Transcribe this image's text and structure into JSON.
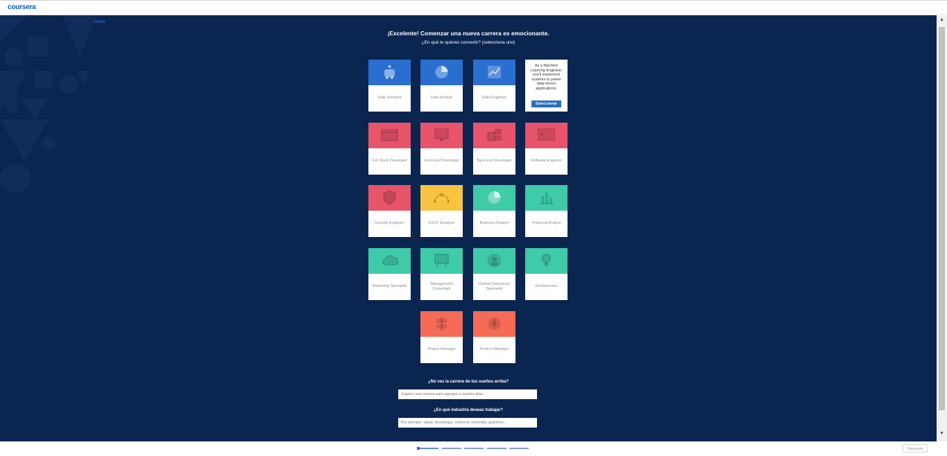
{
  "header": {
    "logo": "coursera"
  },
  "nav": {
    "back_label": "Volver"
  },
  "heading": {
    "title": "¡Excelente! Comenzar una nueva carrera es emocionante.",
    "subtitle": "¿En qué te quieres convertir? (selecciona uno)"
  },
  "careers": [
    {
      "label": "Data Scientist",
      "color": "#2a6fd0",
      "icon": "robot-icon"
    },
    {
      "label": "Data Analyst",
      "color": "#2a6fd0",
      "icon": "pie-chart-icon"
    },
    {
      "label": "Data Engineer",
      "color": "#2a6fd0",
      "icon": "line-chart-icon"
    },
    {
      "label": "Machine Learning Engineer",
      "color": "#2a6fd0",
      "icon": "brain-icon",
      "selected": true,
      "description": "As a Machine Learning Engineer, you'll implement systems to power data-driven applications.",
      "select_label": "Seleccionar"
    },
    {
      "label": "Full Stack Developer",
      "color": "#e8546a",
      "icon": "browser-icon"
    },
    {
      "label": "Front End Developer",
      "color": "#e8546a",
      "icon": "code-monitor-icon"
    },
    {
      "label": "Back End Developer",
      "color": "#e8546a",
      "icon": "server-icon"
    },
    {
      "label": "Software Engineer",
      "color": "#e8546a",
      "icon": "terminal-icon"
    },
    {
      "label": "Security Engineer",
      "color": "#e8546a",
      "icon": "shield-icon"
    },
    {
      "label": "UI/UX Designer",
      "color": "#f8c341",
      "icon": "pen-tool-icon"
    },
    {
      "label": "Business Analyst",
      "color": "#3fcaa8",
      "icon": "pie-chart-icon"
    },
    {
      "label": "Financial Analyst",
      "color": "#3fcaa8",
      "icon": "bar-chart-icon"
    },
    {
      "label": "Marketing Specialist",
      "color": "#3fcaa8",
      "icon": "cloud-icon"
    },
    {
      "label": "Management Consultant",
      "color": "#3fcaa8",
      "icon": "presentation-icon"
    },
    {
      "label": "Human Resources Specialist",
      "color": "#3fcaa8",
      "icon": "person-icon"
    },
    {
      "label": "Entrepreneur",
      "color": "#3fcaa8",
      "icon": "lightbulb-icon"
    },
    {
      "label": "Project Manager",
      "color": "#f56b56",
      "icon": "signpost-icon"
    },
    {
      "label": "Product Manager",
      "color": "#f56b56",
      "icon": "rocket-icon"
    }
  ],
  "dream_career": {
    "question": "¿No ves la carrera de tus sueños arriba?",
    "placeholder": "Sugiere una carrera para agregar a nuestra lista..."
  },
  "industry": {
    "question": "¿En qué industria deseas trabajar?",
    "placeholder": "Por ejemplo: salud, tecnología, comercio minorista, gobierno..."
  },
  "footer": {
    "next_label": "Siguiente",
    "steps_total": 5,
    "current_step": 1
  },
  "colors": {
    "background": "#0a2550",
    "accent": "#0056d2"
  }
}
